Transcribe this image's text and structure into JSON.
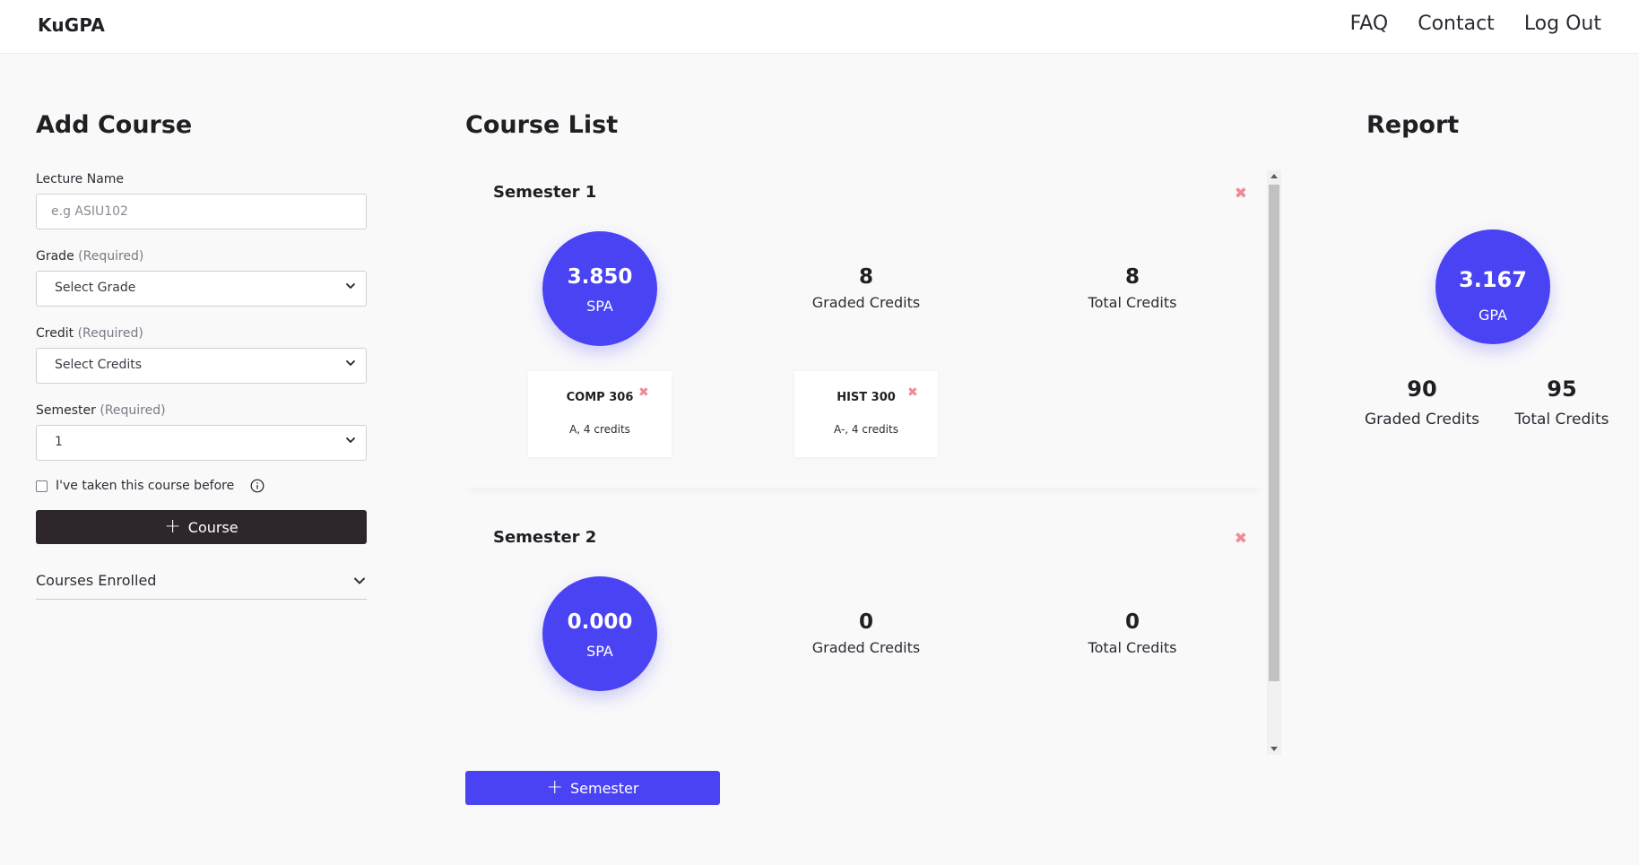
{
  "nav": {
    "brand": "KuGPA",
    "links": [
      "FAQ",
      "Contact",
      "Log Out"
    ]
  },
  "add_course": {
    "title": "Add Course",
    "lecture_label": "Lecture Name",
    "lecture_placeholder": "e.g ASIU102",
    "lecture_value": "",
    "grade_label": "Grade",
    "grade_required": "(Required)",
    "grade_value": "Select Grade",
    "credit_label": "Credit",
    "credit_required": "(Required)",
    "credit_value": "Select Credits",
    "semester_label": "Semester",
    "semester_required": "(Required)",
    "semester_value": "1",
    "retake_label": "I've taken this course before",
    "retake_checked": false,
    "add_button": "Course",
    "enrolled_label": "Courses Enrolled"
  },
  "course_list": {
    "title": "Course List",
    "add_semester_button": "Semester",
    "semesters": [
      {
        "name": "Semester 1",
        "spa": "3.850",
        "spa_label": "SPA",
        "graded_credits": "8",
        "graded_credits_label": "Graded Credits",
        "total_credits": "8",
        "total_credits_label": "Total Credits",
        "courses": [
          {
            "code": "COMP 306",
            "detail": "A, 4 credits"
          },
          {
            "code": "HIST 300",
            "detail": "A-, 4 credits"
          }
        ]
      },
      {
        "name": "Semester 2",
        "spa": "0.000",
        "spa_label": "SPA",
        "graded_credits": "0",
        "graded_credits_label": "Graded Credits",
        "total_credits": "0",
        "total_credits_label": "Total Credits",
        "courses": []
      }
    ]
  },
  "report": {
    "title": "Report",
    "gpa": "3.167",
    "gpa_label": "GPA",
    "graded_credits": "90",
    "graded_credits_label": "Graded Credits",
    "total_credits": "95",
    "total_credits_label": "Total Credits"
  },
  "colors": {
    "accent": "#4a43f3",
    "dark_button": "#2d272c",
    "remove": "#ef8a98"
  },
  "icons": {
    "remove": "close-x-icon",
    "plus": "plus-icon",
    "chevron": "chevron-down-icon",
    "info": "info-icon"
  }
}
